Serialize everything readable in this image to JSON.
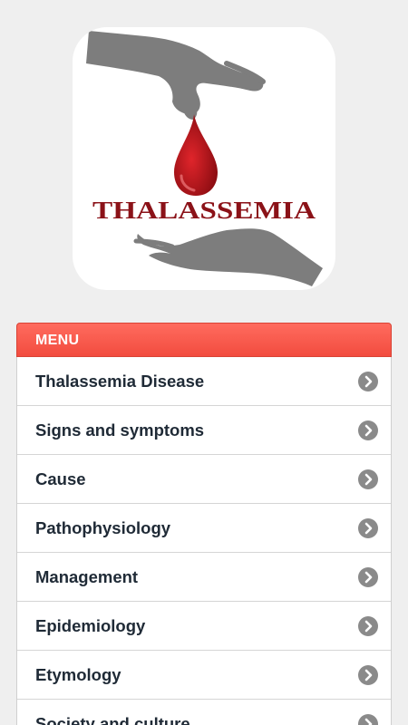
{
  "logo": {
    "text": "THALASSEMIA",
    "icon": "hands-blood-drop-icon",
    "text_color": "#8b1218",
    "drop_color": "#c0161c",
    "hand_color": "#7d7d7d"
  },
  "menu": {
    "header_label": "MENU",
    "header_color": "#f95a4c",
    "items": [
      {
        "label": "Thalassemia Disease",
        "icon": "chevron-right-circle-icon"
      },
      {
        "label": "Signs and symptoms",
        "icon": "chevron-right-circle-icon"
      },
      {
        "label": "Cause",
        "icon": "chevron-right-circle-icon"
      },
      {
        "label": "Pathophysiology",
        "icon": "chevron-right-circle-icon"
      },
      {
        "label": "Management",
        "icon": "chevron-right-circle-icon"
      },
      {
        "label": "Epidemiology",
        "icon": "chevron-right-circle-icon"
      },
      {
        "label": "Etymology",
        "icon": "chevron-right-circle-icon"
      },
      {
        "label": "Society and culture",
        "icon": "chevron-right-circle-icon"
      }
    ]
  }
}
